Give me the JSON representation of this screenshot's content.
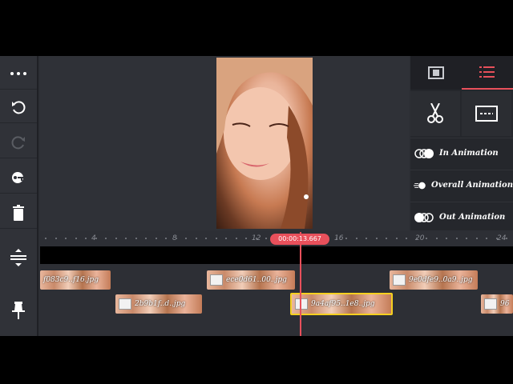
{
  "app": {
    "toolbar": {
      "more_icon": "more-icon",
      "undo_icon": "undo-icon",
      "redo_icon": "redo-icon",
      "keyframe_icon": "keyframe-icon",
      "delete_icon": "trash-icon"
    },
    "right_panel": {
      "tabs": [
        {
          "icon": "media-icon",
          "active": false
        },
        {
          "icon": "layer-list-icon",
          "active": true
        }
      ],
      "tools": [
        {
          "icon": "scissors-icon"
        },
        {
          "icon": "caption-icon"
        }
      ],
      "animations": [
        {
          "label": "In Animation",
          "icon": "in-animation-icon"
        },
        {
          "label": "Overall Animation",
          "icon": "overall-animation-icon"
        },
        {
          "label": "Out Animation",
          "icon": "out-animation-icon"
        }
      ]
    },
    "timeline": {
      "current_time": "00:00:13.667",
      "ruler_labels": [
        "4",
        "8",
        "12",
        "16",
        "20",
        "24"
      ],
      "clips_row1": [
        {
          "name": "f083c9..f16.jpg"
        },
        {
          "name": "ece0d61..00..jpg"
        },
        {
          "name": "9e0dfe9..0a9..jpg"
        }
      ],
      "clips_row2": [
        {
          "name": "2b9b1f..d..jpg"
        },
        {
          "name": "9a4af95..1e8..jpg",
          "selected": true
        },
        {
          "name": "96"
        }
      ]
    }
  },
  "colors": {
    "accent": "#e8505b",
    "selection": "#f5d020",
    "panel": "#2d2f35"
  }
}
